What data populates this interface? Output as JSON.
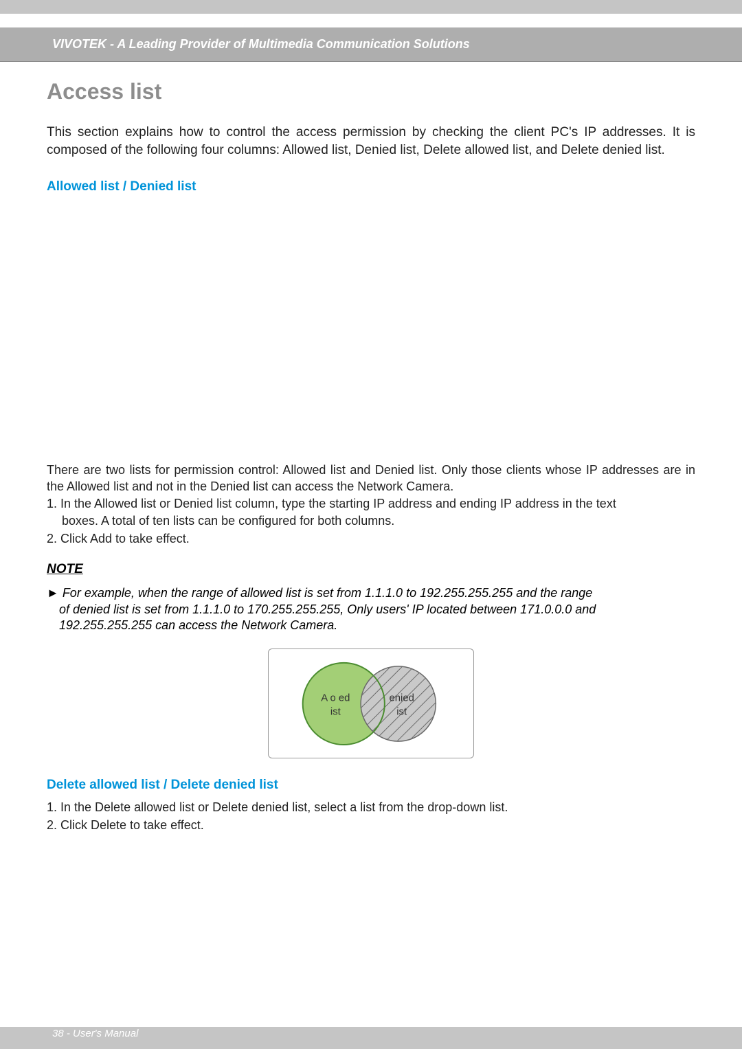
{
  "header": {
    "brand_line": "VIVOTEK - A Leading Provider of Multimedia Communication Solutions"
  },
  "title": "Access list",
  "intro": "This section explains how to control the access permission by checking the client PC's IP addresses. It is composed of the following four columns: Allowed list, Denied list, Delete allowed list, and Delete denied list.",
  "section1": {
    "heading": "Allowed list / Denied list",
    "para": "There are two lists for permission control: Allowed list and Denied list. Only those clients whose IP addresses are in the Allowed list and not in the Denied list can access the Network Camera.",
    "item1a": "1. In the Allowed list or Denied list column, type the starting IP address and ending IP address in the text",
    "item1b": "boxes. A total of ten lists can be configured for both columns.",
    "item2": "2. Click Add to take effect."
  },
  "note": {
    "heading": "NOTE",
    "line1": "► For example, when the range of allowed list is set from 1.1.1.0 to 192.255.255.255 and the range",
    "line2": "of denied list is set from 1.1.1.0 to 170.255.255.255, Only users' IP located between 171.0.0.0 and",
    "line3": "192.255.255.255 can access the Network Camera."
  },
  "venn": {
    "allowed_label_1": "A o ed",
    "allowed_label_2": "ist",
    "denied_label_1": "enied",
    "denied_label_2": "ist"
  },
  "section2": {
    "heading": "Delete allowed list / Delete denied list",
    "item1": "1. In the Delete allowed list or Delete denied list, select a list from the drop-down list.",
    "item2": "2. Click Delete to take effect."
  },
  "footer": "38 - User's Manual"
}
